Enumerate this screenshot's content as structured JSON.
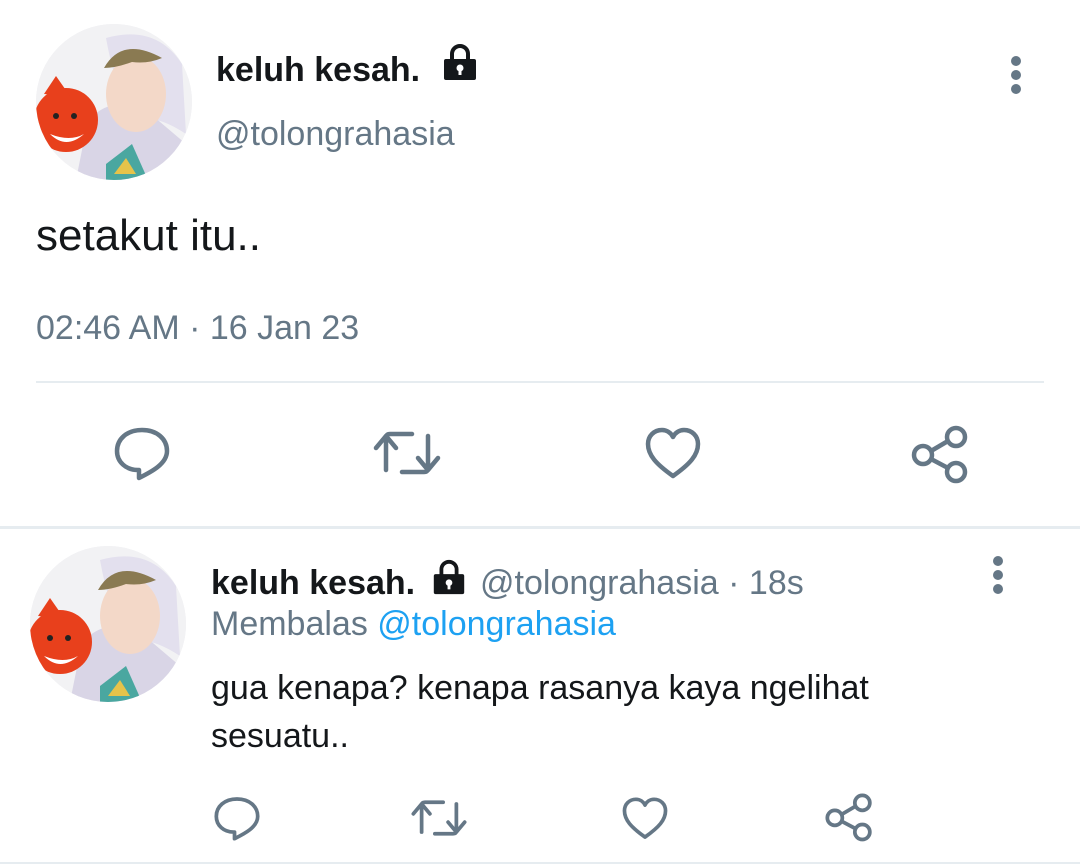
{
  "main_tweet": {
    "display_name": "keluh kesah.",
    "handle": "@tolongrahasia",
    "text": "setakut itu..",
    "timestamp": "02:46 AM · 16 Jan 23",
    "protected_icon": "lock-icon",
    "more_icon": "more-vertical-icon",
    "actions": [
      "reply-icon",
      "retweet-icon",
      "like-icon",
      "share-icon"
    ]
  },
  "reply_tweet": {
    "display_name": "keluh kesah.",
    "handle": "@tolongrahasia",
    "time_sep": "·",
    "time": "18s",
    "replying_label": "Membalas",
    "replying_to": "@tolongrahasia",
    "text_line1": "gua kenapa? kenapa rasanya kaya ngelihat",
    "text_line2": "sesuatu..",
    "protected_icon": "lock-icon",
    "more_icon": "more-vertical-icon",
    "actions": [
      "reply-icon",
      "retweet-icon",
      "like-icon",
      "share-icon"
    ]
  },
  "colors": {
    "text": "#14171a",
    "muted": "#657786",
    "link": "#1da1f2",
    "divider": "#e6ecf0"
  }
}
